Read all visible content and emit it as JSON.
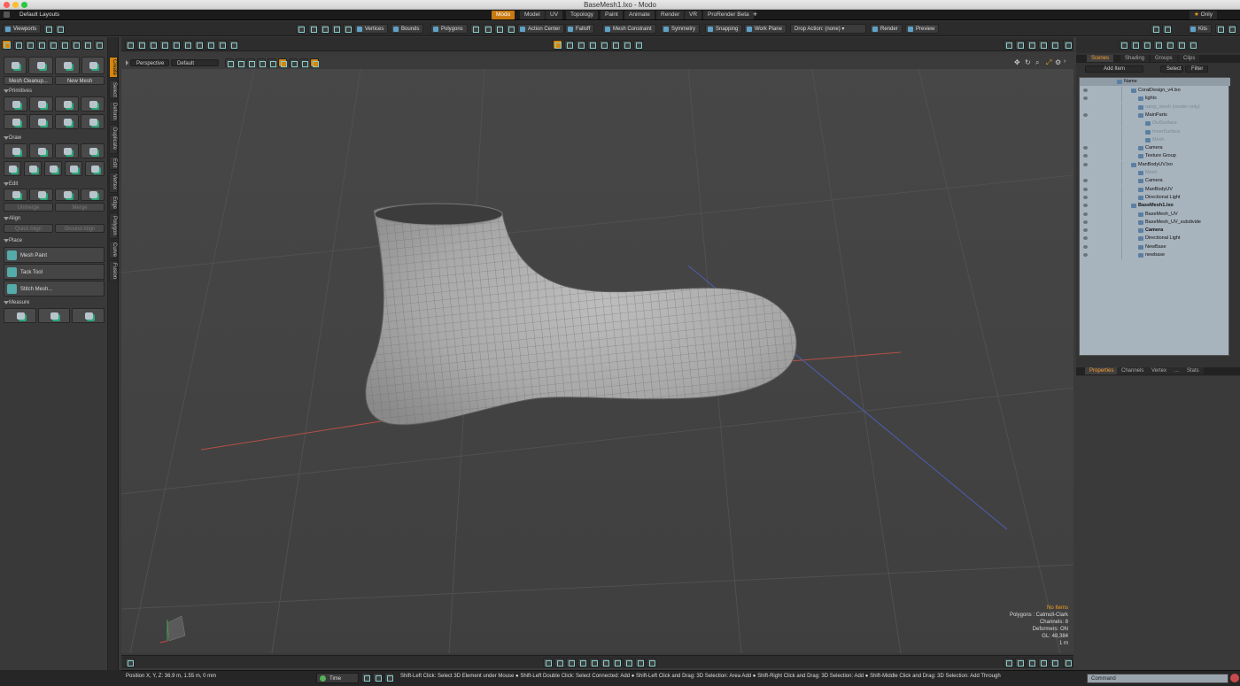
{
  "app": {
    "title": "BaseMesh1.lxo - Modo"
  },
  "layout_bar": {
    "layout_label": "Default Layouts",
    "tabs": [
      "Modo",
      "Model",
      "UV",
      "Topology",
      "Paint",
      "Animate",
      "Render",
      "VR",
      "ProRender Beta"
    ],
    "active_tab": "Modo",
    "only_label": "Only"
  },
  "toolbar": {
    "viewports": "Viewports",
    "vertices": "Vertices",
    "bounds": "Bounds",
    "polygons": "Polygons",
    "action_center": "Action Center",
    "falloff": "Falloff",
    "mesh_constraint": "Mesh Constraint",
    "symmetry": "Symmetry",
    "snapping": "Snapping",
    "work_plane": "Work Plane",
    "drop_action": "Drop Action: (none)",
    "render": "Render",
    "preview": "Preview",
    "kits": "Kits"
  },
  "left_tabs": [
    "Create",
    "Select",
    "Deform",
    "Duplicate",
    "Edit",
    "Vertex",
    "Edge",
    "Polygon",
    "Curve",
    "Fusion"
  ],
  "left_panel": {
    "mesh_cleanup": "Mesh Cleanup...",
    "new_mesh": "New Mesh",
    "sections": {
      "primitives": "Primitives",
      "draw": "Draw",
      "edit": "Edit",
      "align": "Align",
      "place": "Place",
      "measure": "Measure"
    },
    "unmerge": "Unmerge",
    "merge": "Merge",
    "quick_align": "Quick Align",
    "ground_align": "Ground Align",
    "mesh_paint": "Mesh Paint",
    "tack_tool": "Tack Tool",
    "stitch_mesh": "Stitch Mesh..."
  },
  "viewport": {
    "view_mode": "Perspective",
    "shading": "Default",
    "stats": {
      "items": "No Items",
      "polygons": "Polygons : Catmull-Clark",
      "channels": "Channels: 8",
      "deformers": "Deformers: ON",
      "gl": "GL: 48,384",
      "scale": "1 m"
    },
    "accent_color": "#f0a020"
  },
  "status": {
    "position": "Position X, Y, Z:   36.9 m, 1.55 m, 0 mm",
    "time": "Time",
    "hint": "Shift-Left Click: Select 3D Element under Mouse ● Shift-Left Double Click: Select Connected: Add ● Shift-Left Click and Drag: 3D Selection: Area Add ● Shift-Right Click and Drag: 3D Selection: Add ● Shift-Middle Click and Drag: 3D Selection: Add Through",
    "command_placeholder": "Command"
  },
  "right_panel": {
    "tabs": [
      "Scenes",
      "Shading",
      "Groups",
      "Clips"
    ],
    "active_tab": "Scenes",
    "add_item": "Add Item",
    "select": "Select",
    "filter": "Filter",
    "name_header": "Name",
    "tree": [
      {
        "label": "CoralDesign_v4.lxo",
        "indent": 0,
        "eye": true,
        "dim": false,
        "bold": false
      },
      {
        "label": "lights",
        "indent": 1,
        "eye": true,
        "dim": false,
        "bold": false
      },
      {
        "label": "ramp_mesh (render only)",
        "indent": 1,
        "eye": false,
        "dim": true,
        "bold": false
      },
      {
        "label": "MainParts",
        "indent": 1,
        "eye": true,
        "dim": false,
        "bold": false
      },
      {
        "label": "OutSurface",
        "indent": 2,
        "eye": false,
        "dim": true,
        "bold": false
      },
      {
        "label": "InnerSurface",
        "indent": 2,
        "eye": false,
        "dim": true,
        "bold": false
      },
      {
        "label": "Mesh",
        "indent": 2,
        "eye": false,
        "dim": true,
        "bold": false
      },
      {
        "label": "Camera",
        "indent": 1,
        "eye": true,
        "dim": false,
        "bold": false
      },
      {
        "label": "Texture Group",
        "indent": 1,
        "eye": true,
        "dim": false,
        "bold": false
      },
      {
        "label": "ManBodyUV.lxo",
        "indent": 0,
        "eye": true,
        "dim": false,
        "bold": false
      },
      {
        "label": "Mesh",
        "indent": 1,
        "eye": false,
        "dim": true,
        "bold": false
      },
      {
        "label": "Camera",
        "indent": 1,
        "eye": true,
        "dim": false,
        "bold": false
      },
      {
        "label": "ManBodyUV",
        "indent": 1,
        "eye": true,
        "dim": false,
        "bold": false
      },
      {
        "label": "Directional Light",
        "indent": 1,
        "eye": true,
        "dim": false,
        "bold": false
      },
      {
        "label": "BaseMesh1.lxo",
        "indent": 0,
        "eye": true,
        "dim": false,
        "bold": true
      },
      {
        "label": "BaseMesh_UV",
        "indent": 1,
        "eye": true,
        "dim": false,
        "bold": false
      },
      {
        "label": "BaseMesh_UV_subdivide",
        "indent": 1,
        "eye": true,
        "dim": false,
        "bold": false
      },
      {
        "label": "Camera",
        "indent": 1,
        "eye": true,
        "dim": false,
        "bold": true
      },
      {
        "label": "Directional Light",
        "indent": 1,
        "eye": true,
        "dim": false,
        "bold": false
      },
      {
        "label": "NewBase",
        "indent": 1,
        "eye": true,
        "dim": false,
        "bold": false
      },
      {
        "label": "newbase",
        "indent": 1,
        "eye": true,
        "dim": false,
        "bold": false
      }
    ],
    "prop_tabs": [
      "Properties",
      "Channels",
      "Vertex",
      "...",
      "Stats"
    ],
    "prop_active": "Properties"
  }
}
